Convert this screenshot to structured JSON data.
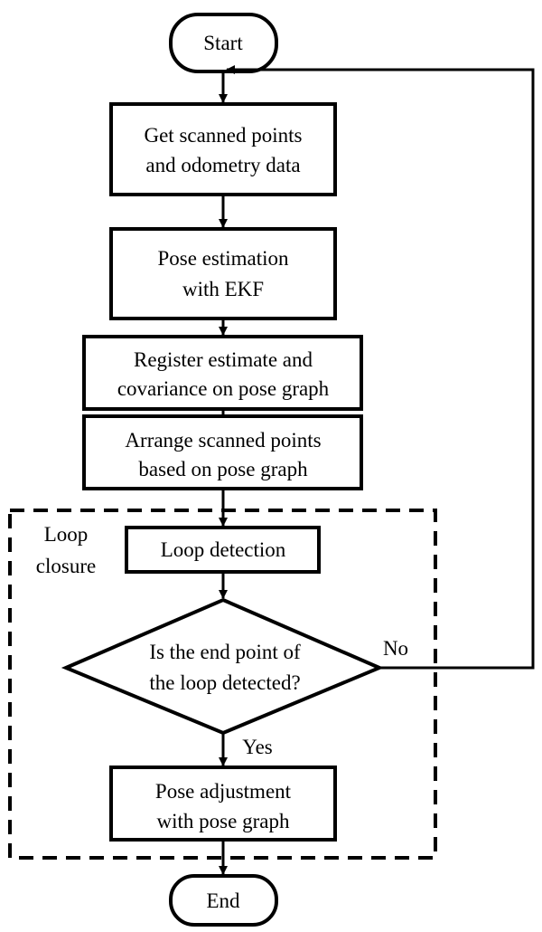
{
  "nodes": {
    "start": "Start",
    "get_data": [
      "Get scanned points",
      "and odometry data"
    ],
    "pose_est": [
      "Pose estimation",
      "with EKF"
    ],
    "register": [
      "Register estimate and",
      "covariance on pose graph"
    ],
    "arrange": [
      "Arrange scanned points",
      "based on pose graph"
    ],
    "loop_detection": "Loop detection",
    "decision": [
      "Is the end point of",
      "the loop detected?"
    ],
    "pose_adjust": [
      "Pose adjustment",
      "with pose graph"
    ],
    "end": "End"
  },
  "group": {
    "label": [
      "Loop",
      "closure"
    ]
  },
  "edges": {
    "no": "No",
    "yes": "Yes"
  },
  "colors": {
    "stroke": "#000000",
    "background": "#ffffff"
  }
}
